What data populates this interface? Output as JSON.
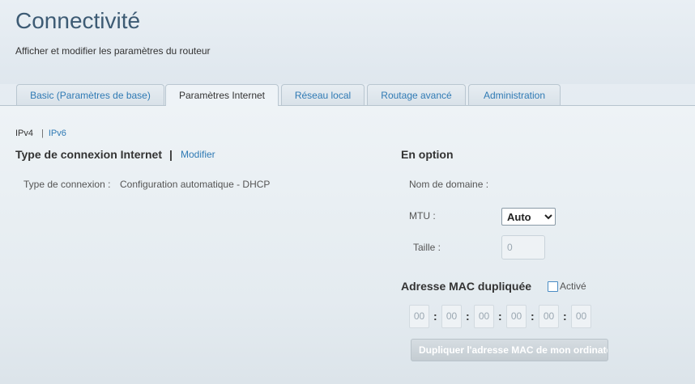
{
  "page": {
    "title": "Connectivité",
    "subtitle": "Afficher et modifier les paramètres du routeur"
  },
  "tabs": [
    {
      "label": "Basic (Paramètres de base)",
      "active": false
    },
    {
      "label": "Paramètres Internet",
      "active": true
    },
    {
      "label": "Réseau local",
      "active": false
    },
    {
      "label": "Routage avancé",
      "active": false
    },
    {
      "label": "Administration",
      "active": false
    }
  ],
  "ip_nav": {
    "ipv4": "IPv4",
    "separator": "|",
    "ipv6": "IPv6"
  },
  "connection": {
    "title": "Type de connexion Internet",
    "separator": "|",
    "edit_link": "Modifier",
    "type_label": "Type de connexion :",
    "type_value": "Configuration automatique - DHCP"
  },
  "optional": {
    "title": "En option",
    "domain_label": "Nom de domaine :",
    "mtu_label": "MTU :",
    "mtu_value": "Auto",
    "size_label": "Taille :",
    "size_value": "0"
  },
  "mac_clone": {
    "title": "Adresse MAC dupliquée",
    "enabled_label": "Activé",
    "enabled": false,
    "octets": [
      "00",
      "00",
      "00",
      "00",
      "00",
      "00"
    ],
    "colon": ":",
    "clone_button": "Dupliquer l'adresse MAC de mon ordinateur"
  },
  "colors": {
    "accent": "#2f7ab4",
    "title": "#3d5b74"
  }
}
